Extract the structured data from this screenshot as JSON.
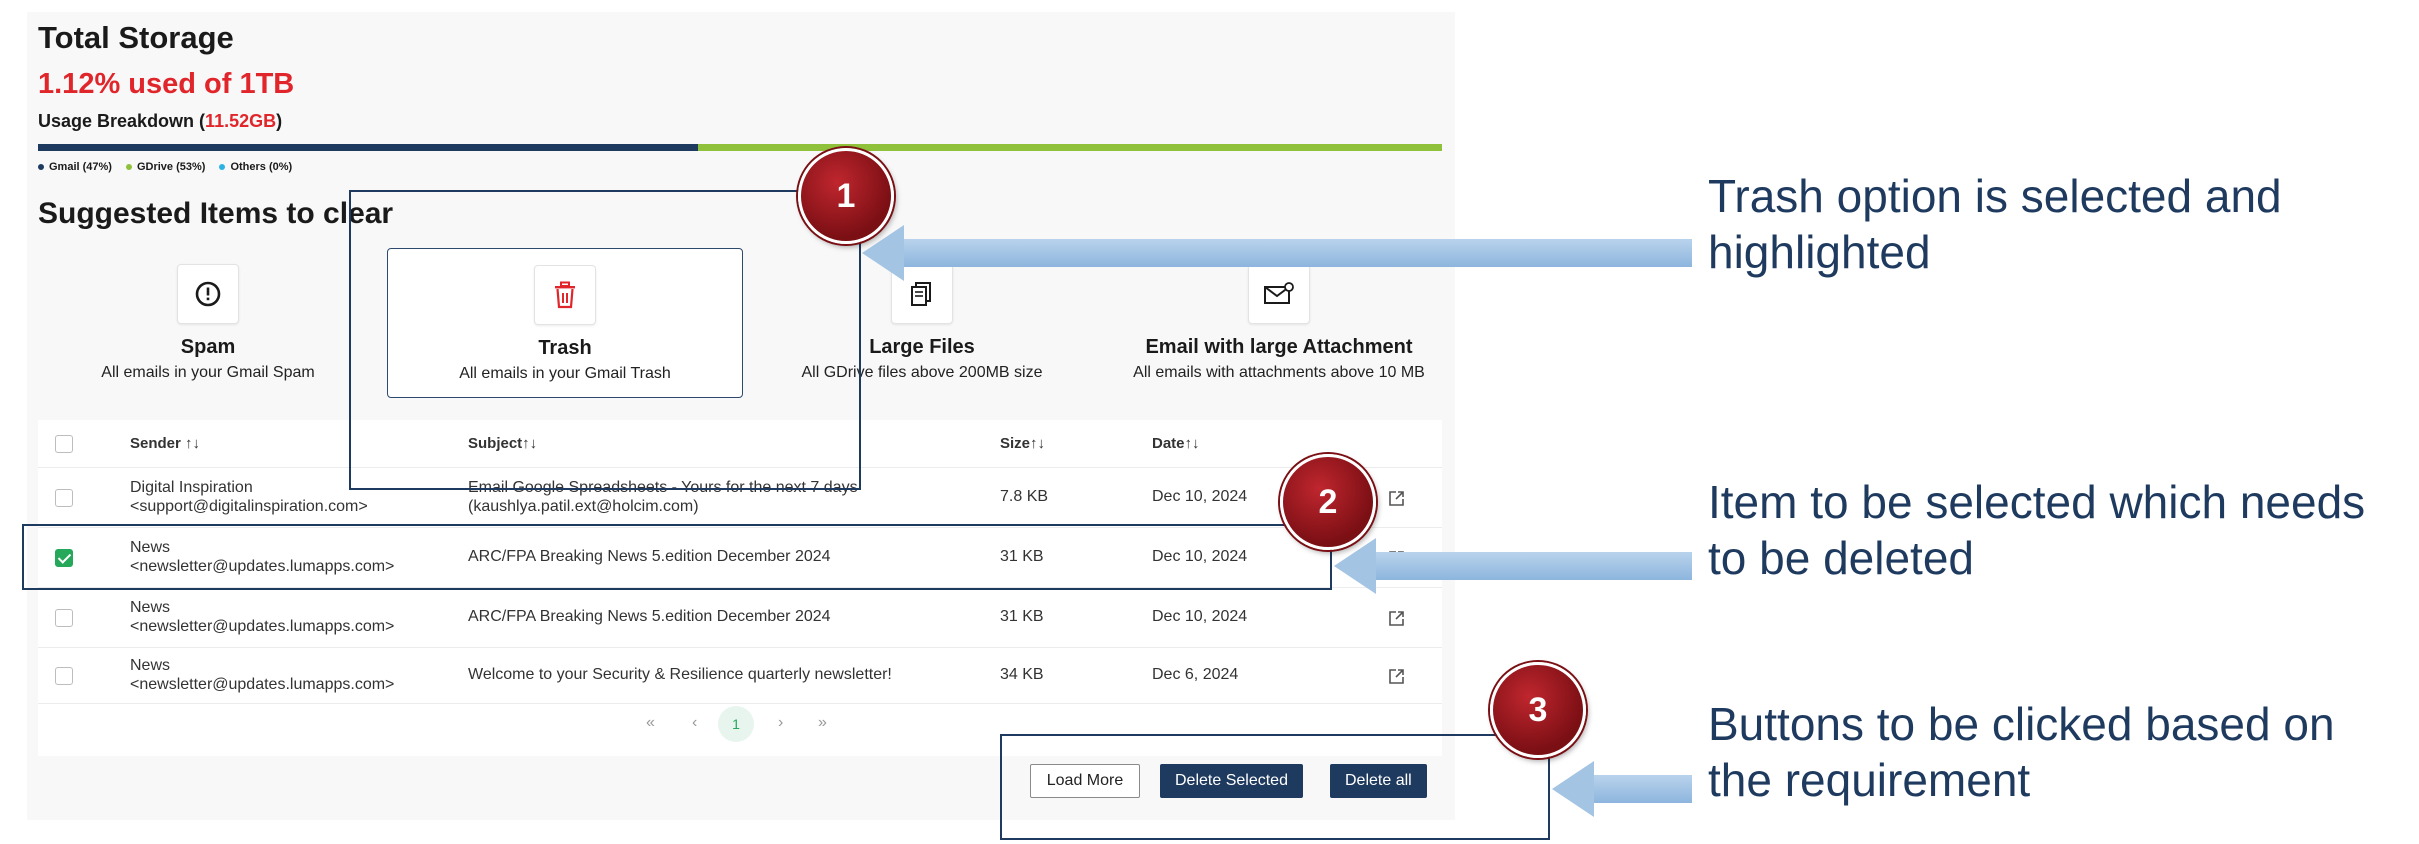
{
  "storage": {
    "title": "Total Storage",
    "used_text": "1.12% used of 1TB",
    "breakdown_label": "Usage Breakdown (",
    "breakdown_size": "11.52GB",
    "breakdown_close": ")",
    "bar_split_percent": 47,
    "legend": [
      {
        "label": "Gmail (47%)",
        "color": "#1f3a5f"
      },
      {
        "label": "GDrive (53%)",
        "color": "#8fc13b"
      },
      {
        "label": "Others (0%)",
        "color": "#2bb3e6"
      }
    ]
  },
  "suggested": {
    "title": "Suggested Items to clear",
    "cards": [
      {
        "name": "Spam",
        "desc": "All emails in your Gmail Spam",
        "icon": "alert-circle-icon"
      },
      {
        "name": "Trash",
        "desc": "All emails in your Gmail Trash",
        "icon": "trash-icon",
        "selected": true
      },
      {
        "name": "Large Files",
        "desc": "All GDrive files above 200MB size",
        "icon": "files-icon"
      },
      {
        "name": "Email with large Attachment",
        "desc": "All emails with attachments above 10 MB",
        "icon": "mail-attachment-icon"
      }
    ]
  },
  "table": {
    "headers": {
      "sender": "Sender ↑↓",
      "subject": "Subject↑↓",
      "size": "Size↑↓",
      "date": "Date↑↓"
    },
    "rows": [
      {
        "sender1": "Digital Inspiration",
        "sender2": "<support@digitalinspiration.com>",
        "subject1": "Email Google Spreadsheets - Yours for the next 7 days",
        "subject2": "(kaushlya.patil.ext@holcim.com)",
        "size": "7.8 KB",
        "date": "Dec 10, 2024",
        "checked": false
      },
      {
        "sender1": "News",
        "sender2": "<newsletter@updates.lumapps.com>",
        "subject1": "ARC/FPA Breaking News 5.edition December 2024",
        "subject2": "",
        "size": "31 KB",
        "date": "Dec 10, 2024",
        "checked": true
      },
      {
        "sender1": "News",
        "sender2": "<newsletter@updates.lumapps.com>",
        "subject1": "ARC/FPA Breaking News 5.edition December 2024",
        "subject2": "",
        "size": "31 KB",
        "date": "Dec 10, 2024",
        "checked": false
      },
      {
        "sender1": "News",
        "sender2": "<newsletter@updates.lumapps.com>",
        "subject1": "Welcome to your Security & Resilience quarterly newsletter!",
        "subject2": "",
        "size": "34 KB",
        "date": "Dec 6, 2024",
        "checked": false
      }
    ]
  },
  "pagination": {
    "first": "«",
    "prev": "‹",
    "current": "1",
    "next": "›",
    "last": "»"
  },
  "buttons": {
    "load_more": "Load More",
    "delete_selected": "Delete Selected",
    "delete_all": "Delete all"
  },
  "annotations": [
    {
      "number": "1",
      "text": "Trash option is selected and highlighted"
    },
    {
      "number": "2",
      "text": "Item to be selected which needs to be deleted"
    },
    {
      "number": "3",
      "text": "Buttons to be clicked based on the requirement"
    }
  ],
  "colors": {
    "accent": "#1f3a5f",
    "danger": "#e0262b",
    "success": "#26a85a",
    "badge": "#9b1c22",
    "arrow": "#a4c4e4"
  }
}
